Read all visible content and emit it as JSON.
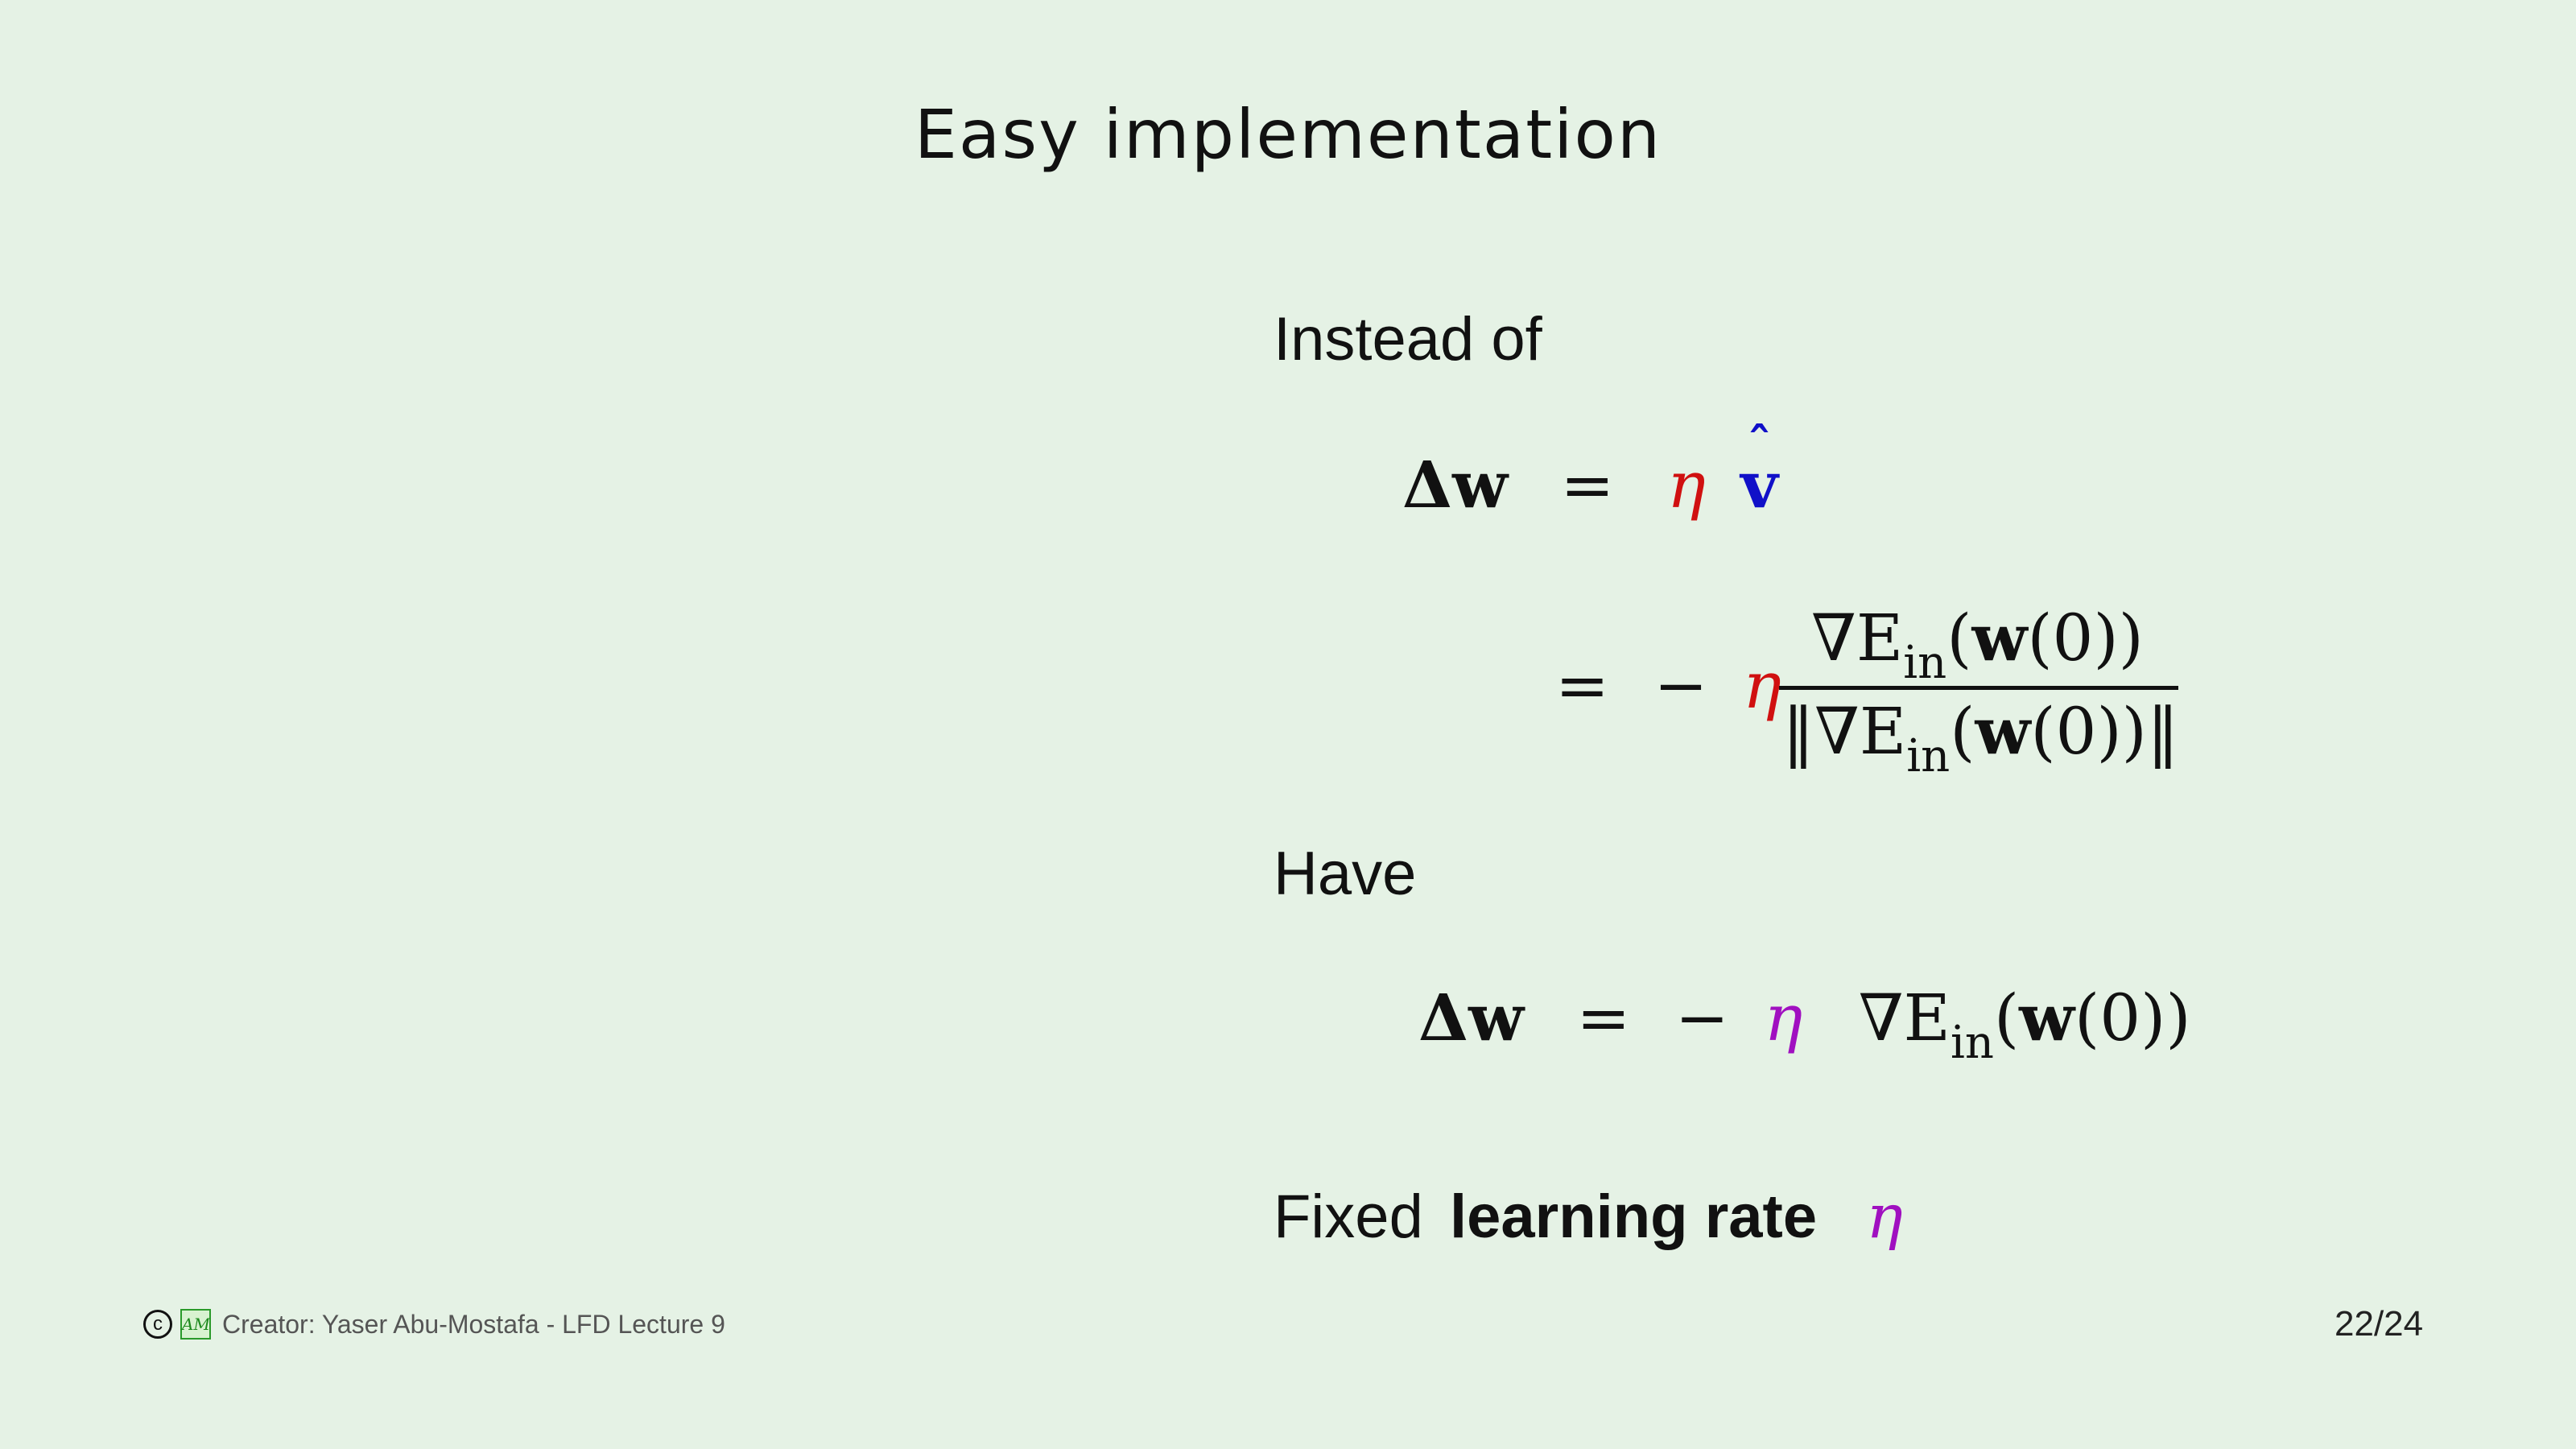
{
  "slide": {
    "title": "Easy implementation",
    "instead_of_label": "Instead of",
    "have_label": "Have",
    "fixed_prefix": "Fixed",
    "fixed_bold": "learning rate",
    "eta": "η"
  },
  "equations": {
    "delta_w": "Δw",
    "equals": "=",
    "minus": "−",
    "v_hat": "v",
    "hat": "ˆ",
    "nabla_E": "∇E",
    "sub_in": "in",
    "w0_open": "(",
    "w0": "w",
    "w0_rest": "(0))",
    "norm_open": "‖∇E",
    "norm_close": "(0))‖"
  },
  "footer": {
    "copyright": "c",
    "logo": "AM",
    "creator": "Creator:  Yaser Abu-Mostafa - LFD Lecture 9",
    "page": "22/24"
  },
  "colors": {
    "background": "#e5f2e5",
    "eta_red": "#d01010",
    "v_blue": "#1010c8",
    "eta_purple": "#a010c0"
  }
}
